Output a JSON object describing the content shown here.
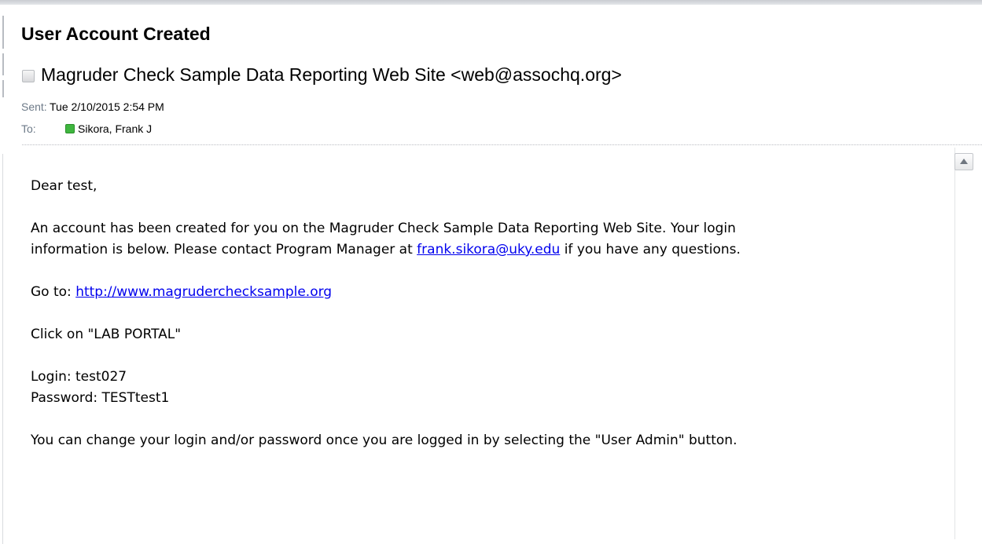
{
  "message": {
    "subject": "User Account Created",
    "from": "Magruder Check Sample Data Reporting Web Site <web@assochq.org>",
    "sent_label": "Sent:",
    "sent_value": "Tue 2/10/2015 2:54 PM",
    "to_label": "To:",
    "to_value": "Sikora, Frank J"
  },
  "body": {
    "greeting": "Dear test,",
    "paragraph1_line1": "An account has been created for you on the Magruder Check Sample Data Reporting Web Site.  Your login",
    "paragraph1_line2_prefix": "information is below.  Please contact Program Manager at ",
    "contact_email": "frank.sikora@uky.edu",
    "paragraph1_line2_suffix": " if you have any questions.",
    "goto_prefix": "Go to: ",
    "site_url": "http://www.magrudercheck sample.org",
    "site_url_text": "http://www.magruderchecksample.org",
    "click_instruction": "Click on \"LAB PORTAL\"",
    "login_line": "Login: test027",
    "password_line": "Password: TESTtest1",
    "closing": "You can change your login and/or password once you are logged in by selecting the \"User Admin\" button."
  },
  "colors": {
    "link": "#0000ee",
    "meta_label": "#6d7a88",
    "presence_online": "#3fb63f"
  },
  "icons": {
    "sender_presence": "presence-unknown-icon",
    "recipient_presence": "presence-online-icon",
    "scroll_up": "scroll-up-arrow-icon"
  }
}
